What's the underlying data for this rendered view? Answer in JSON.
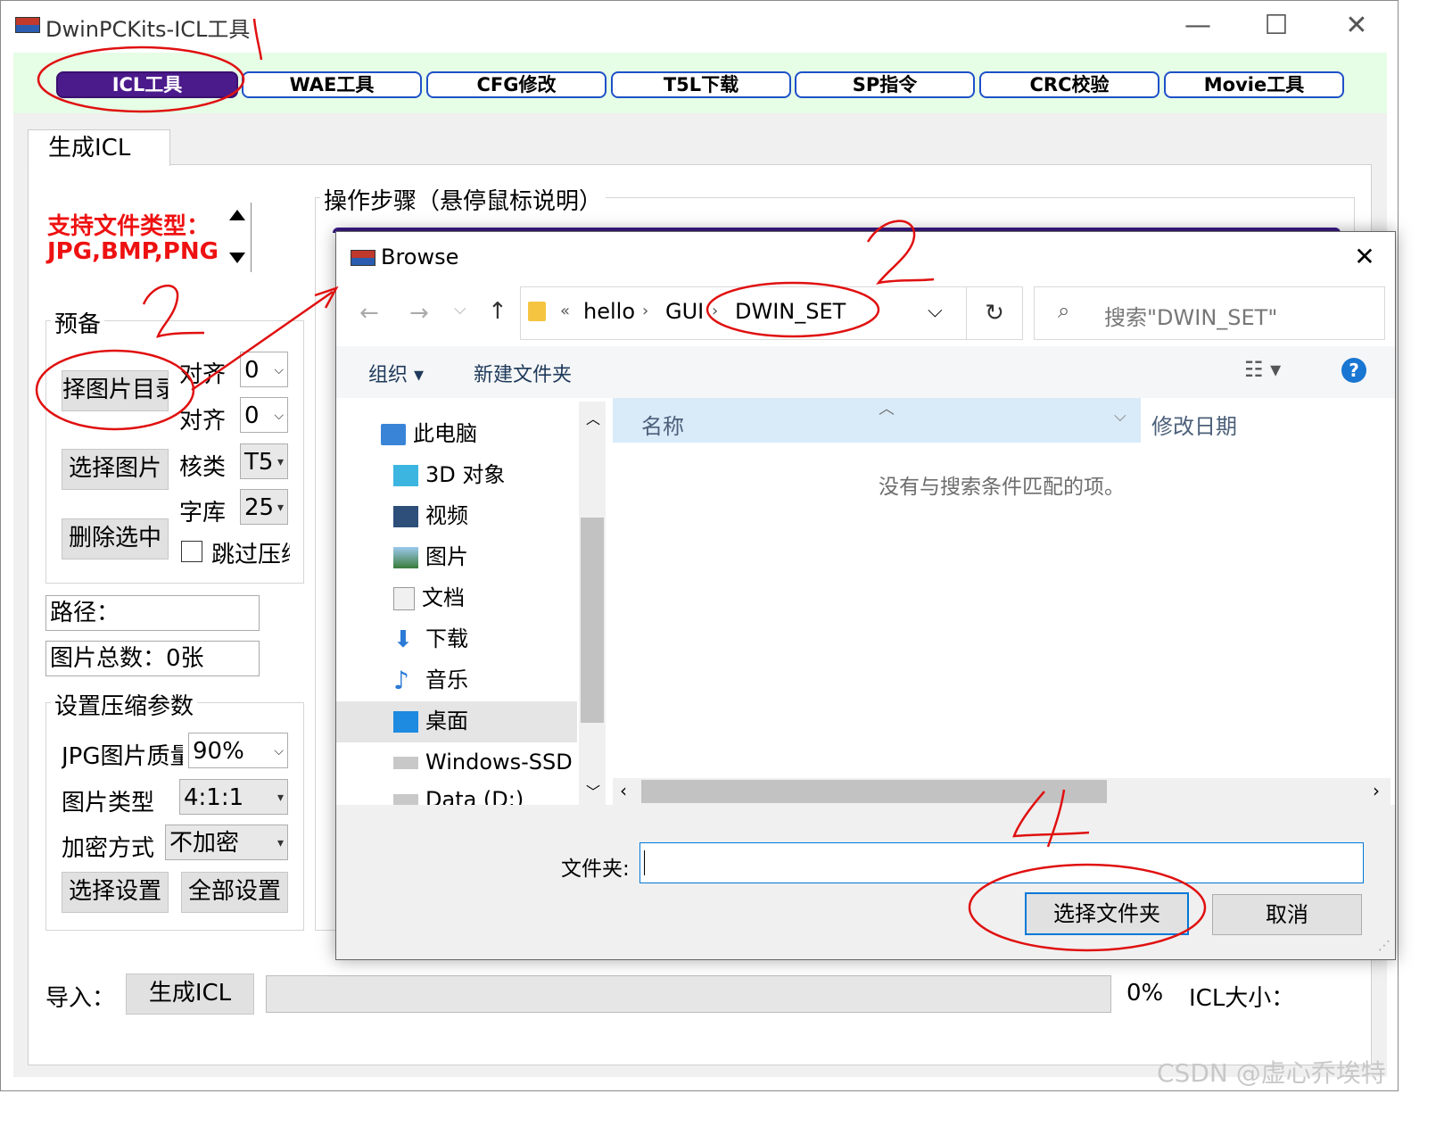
{
  "window": {
    "title": "DwinPCKits-ICL工具",
    "minimize": "—",
    "maximize": "☐",
    "close": "✕"
  },
  "tabs": [
    "ICL工具",
    "WAE工具",
    "CFG修改",
    "T5L下载",
    "SP指令",
    "CRC校验",
    "Movie工具"
  ],
  "page_tab": "生成ICL",
  "left_panel": {
    "support_label": "支持文件类型：",
    "support_types": "JPG,BMP,PNG",
    "prep_group": "预备",
    "btn_select_dir": "择图片目录",
    "btn_select_img": "选择图片",
    "btn_delete": "删除选中",
    "align1_label": "对齐",
    "align1_value": "0",
    "align2_label": "对齐",
    "align2_value": "0",
    "core_label": "核类",
    "core_value": "T5",
    "font_label": "字库",
    "font_value": "25",
    "skip_label": "跳过压缩",
    "path_label": "路径：",
    "count_label": "图片总数：0张",
    "compress_group": "设置压缩参数",
    "jpg_quality_label": "JPG图片质量",
    "jpg_quality_value": "90%",
    "img_type_label": "图片类型",
    "img_type_value": "4:1:1",
    "encrypt_label": "加密方式",
    "encrypt_value": "不加密",
    "btn_select_settings": "选择设置",
    "btn_all_settings": "全部设置"
  },
  "steps_group": "操作步骤（悬停鼠标说明）",
  "bottom": {
    "import_label": "导入：",
    "btn_generate": "生成ICL",
    "progress_text": "0%",
    "progress_value": 0,
    "icl_size_label": "ICL大小："
  },
  "dialog": {
    "title": "Browse",
    "close": "✕",
    "breadcrumb": [
      "hello",
      "GUI",
      "DWIN_SET"
    ],
    "breadcrumb_prefix": "«",
    "search_placeholder": "搜索\"DWIN_SET\"",
    "toolbar_organize": "组织 ▾",
    "toolbar_new_folder": "新建文件夹",
    "help": "?",
    "tree": [
      {
        "label": "此电脑",
        "icon": "computer-icon"
      },
      {
        "label": "3D 对象",
        "icon": "cube-icon"
      },
      {
        "label": "视频",
        "icon": "video-icon"
      },
      {
        "label": "图片",
        "icon": "picture-icon"
      },
      {
        "label": "文档",
        "icon": "document-icon"
      },
      {
        "label": "下载",
        "icon": "download-icon"
      },
      {
        "label": "音乐",
        "icon": "music-icon"
      },
      {
        "label": "桌面",
        "icon": "desktop-icon"
      },
      {
        "label": "Windows-SSD (",
        "icon": "drive-icon"
      },
      {
        "label": "Data (D:)",
        "icon": "drive-icon"
      }
    ],
    "col_name": "名称",
    "col_modified": "修改日期",
    "empty_message": "没有与搜索条件匹配的项。",
    "folder_label": "文件夹:",
    "folder_value": "",
    "btn_select_folder": "选择文件夹",
    "btn_cancel": "取消"
  },
  "annotations": [
    "1",
    "2",
    "2",
    "4"
  ],
  "watermark": "CSDN @虚心乔埃特",
  "colors": {
    "active_tab": "#4b1a8b",
    "tab_border": "#1e50c8",
    "tab_strip_bg": "#e6fde6",
    "annotation_red": "#e01010",
    "label_red": "#ee1111"
  }
}
